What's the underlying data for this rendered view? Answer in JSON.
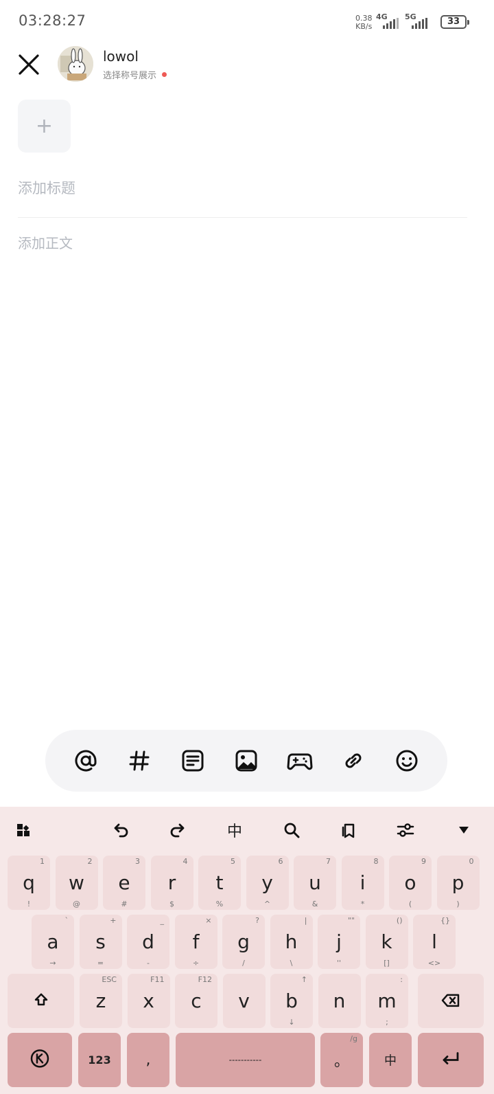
{
  "status_bar": {
    "time": "03:28:27",
    "net_speed_value": "0.38",
    "net_speed_unit": "KB/s",
    "signal_1_label": "4G",
    "signal_2_label": "5G",
    "battery": "33"
  },
  "header": {
    "username": "lowol",
    "nickname_hint": "选择称号展示"
  },
  "editor": {
    "add_media_symbol": "+",
    "title_placeholder": "添加标题",
    "body_placeholder": "添加正文"
  },
  "toolbar_icons": [
    "at-icon",
    "hashtag-icon",
    "text-block-icon",
    "image-icon",
    "game-controller-icon",
    "link-icon",
    "emoji-icon"
  ],
  "keyboard": {
    "toolbar": {
      "lang_label": "中"
    },
    "row1": [
      {
        "key": "q",
        "top": "1",
        "bot": "!"
      },
      {
        "key": "w",
        "top": "2",
        "bot": "@"
      },
      {
        "key": "e",
        "top": "3",
        "bot": "#"
      },
      {
        "key": "r",
        "top": "4",
        "bot": "$"
      },
      {
        "key": "t",
        "top": "5",
        "bot": "%"
      },
      {
        "key": "y",
        "top": "6",
        "bot": "^"
      },
      {
        "key": "u",
        "top": "7",
        "bot": "&"
      },
      {
        "key": "i",
        "top": "8",
        "bot": "*"
      },
      {
        "key": "o",
        "top": "9",
        "bot": "("
      },
      {
        "key": "p",
        "top": "0",
        "bot": ")"
      }
    ],
    "row2": [
      {
        "key": "a",
        "top": "`",
        "bot": "→"
      },
      {
        "key": "s",
        "top": "+",
        "bot": "="
      },
      {
        "key": "d",
        "top": "_",
        "bot": "-"
      },
      {
        "key": "f",
        "top": "×",
        "bot": "÷"
      },
      {
        "key": "g",
        "top": "?",
        "bot": "/"
      },
      {
        "key": "h",
        "top": "|",
        "bot": "\\"
      },
      {
        "key": "j",
        "top": "\"\"",
        "bot": "''"
      },
      {
        "key": "k",
        "top": "()",
        "bot": "[]"
      },
      {
        "key": "l",
        "top": "{}",
        "bot": "<>"
      }
    ],
    "row3": [
      {
        "key": "z",
        "top": "ESC",
        "bot": ""
      },
      {
        "key": "x",
        "top": "F11",
        "bot": ""
      },
      {
        "key": "c",
        "top": "F12",
        "bot": ""
      },
      {
        "key": "v",
        "top": "",
        "bot": ""
      },
      {
        "key": "b",
        "top": "↑",
        "bot": "↓"
      },
      {
        "key": "n",
        "top": "",
        "bot": ""
      },
      {
        "key": "m",
        "top": ":",
        "bot": ";"
      }
    ],
    "row4": {
      "num_label": "123",
      "comma": ",",
      "space": "-----------",
      "period": "。",
      "period_top": "/g",
      "lang": "中"
    }
  }
}
